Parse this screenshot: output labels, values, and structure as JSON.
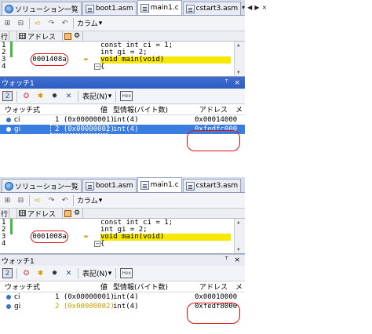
{
  "tabs": [
    {
      "label": "ソリューション一覧",
      "icon": "solution-icon"
    },
    {
      "label": "boot1.asm",
      "icon": "document-icon"
    },
    {
      "label": "main1.c",
      "icon": "document-icon"
    },
    {
      "label": "cstart3.asm",
      "icon": "document-icon"
    }
  ],
  "tabnav": {
    "left": "◀",
    "right": "▶",
    "close": "×"
  },
  "toolbar": {
    "column_label": "カラム",
    "dropdown_arrow": "▾"
  },
  "columns": {
    "line": "行",
    "address": "アドレス"
  },
  "code": {
    "lines": [
      {
        "num": "1",
        "text": "const int ci = 1;"
      },
      {
        "num": "2",
        "text": "int gi = 2;"
      },
      {
        "num": "3",
        "text": "void main(void)"
      },
      {
        "num": "4",
        "text": "{"
      }
    ]
  },
  "panels": [
    {
      "address_value": "0001408a",
      "watch": {
        "title": "ウォッチ1",
        "pin": "ꟸ",
        "close": "×",
        "notation_label": "表記(N)",
        "headers": {
          "expr": "ウォッチ式",
          "value": "値",
          "type": "型情報(バイト数)",
          "address": "アドレス",
          "memo": "メ"
        },
        "rows": [
          {
            "name": "ci",
            "value": "1 (0x00000001)",
            "type": "int(4)",
            "address": "0x00014000",
            "selected": false
          },
          {
            "name": "gi",
            "value": "2 (0x00000002)",
            "type": "int(4)",
            "address": "0xfedfc000",
            "selected": true
          }
        ]
      }
    },
    {
      "address_value": "0001008a",
      "watch": {
        "title": "ウォッチ1",
        "pin": "ꟸ",
        "close": "×",
        "notation_label": "表記(N)",
        "headers": {
          "expr": "ウォッチ式",
          "value": "値",
          "type": "型情報(バイト数)",
          "address": "アドレス",
          "memo": "メ"
        },
        "rows": [
          {
            "name": "ci",
            "value": "1 (0x00000001)",
            "type": "int(4)",
            "address": "0x00010000",
            "selected": false
          },
          {
            "name": "gi",
            "value": "2 (0x00000002)",
            "type": "int(4)",
            "address": "0xfedf8000",
            "selected": false
          }
        ]
      }
    }
  ]
}
